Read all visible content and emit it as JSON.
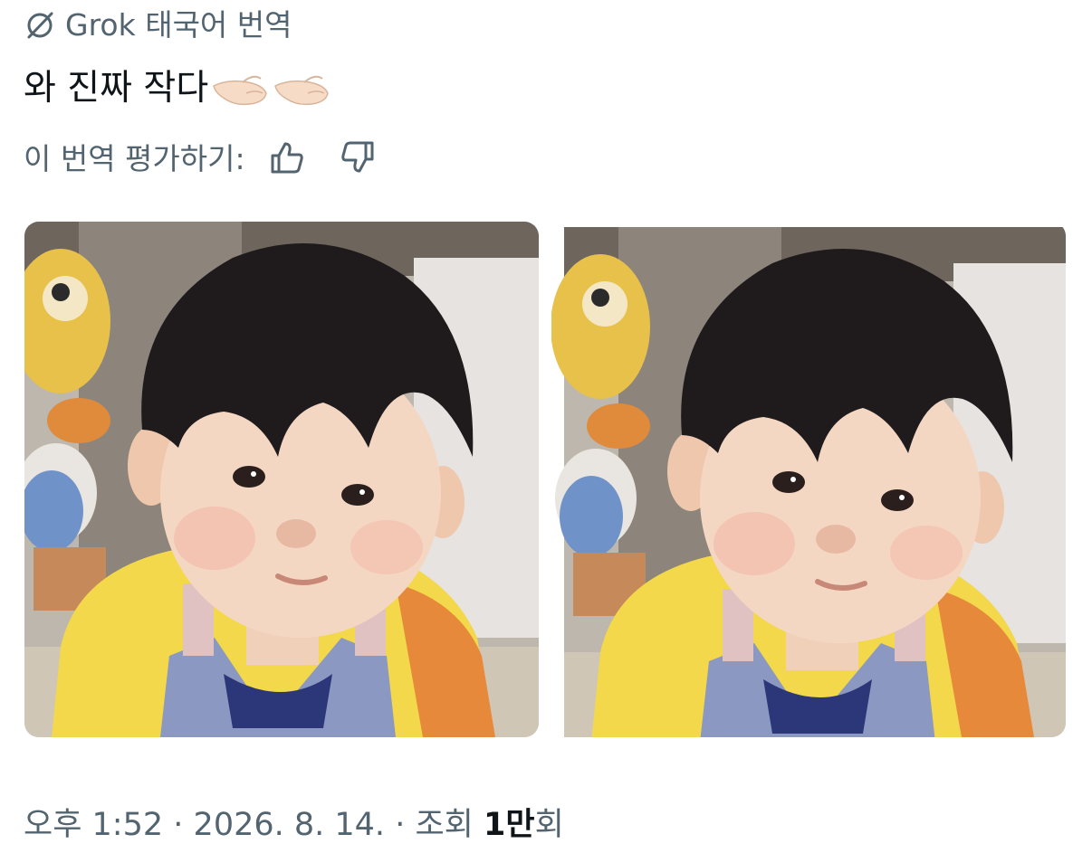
{
  "grok": {
    "icon": "grok-logo-icon",
    "label": "Grok 태국어 번역"
  },
  "post": {
    "translated_text": "와 진짜 작다",
    "emojis": [
      "pinching-hand-icon",
      "pinching-hand-icon"
    ]
  },
  "rating": {
    "label": "이 번역 평가하기:",
    "thumbs_up_icon": "thumbs-up-icon",
    "thumbs_down_icon": "thumbs-down-icon"
  },
  "media": [
    {
      "kind": "photo"
    },
    {
      "kind": "photo"
    }
  ],
  "meta": {
    "time": "오후 1:52",
    "separator": "·",
    "date": "2026. 8. 14.",
    "views_prefix": "조회",
    "views_count": "1만",
    "views_suffix": "회"
  },
  "colors": {
    "text_primary": "#0f1419",
    "text_secondary": "#536471",
    "background": "#ffffff"
  }
}
